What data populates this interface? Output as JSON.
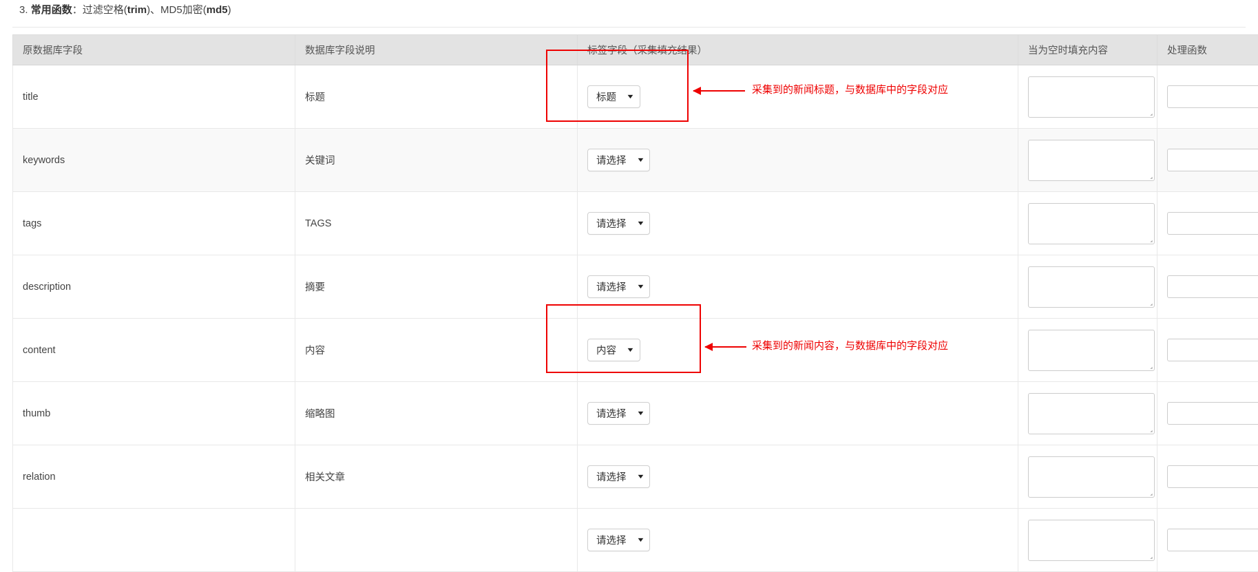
{
  "note": {
    "index": "3.",
    "label": "常用函数",
    "colon": "：",
    "body_1": "过滤空格(",
    "fn_1": "trim",
    "body_2": ")、MD5加密(",
    "fn_2": "md5",
    "body_3": ")"
  },
  "table": {
    "headers": [
      "原数据库字段",
      "数据库字段说明",
      "标签字段（采集填充结果）",
      "当为空时填充内容",
      "处理函数"
    ],
    "rows": [
      {
        "field": "title",
        "desc": "标题",
        "select": "标题",
        "empty_fill": "",
        "handler": ""
      },
      {
        "field": "keywords",
        "desc": "关键词",
        "select": "请选择",
        "empty_fill": "",
        "handler": ""
      },
      {
        "field": "tags",
        "desc": "TAGS",
        "select": "请选择",
        "empty_fill": "",
        "handler": ""
      },
      {
        "field": "description",
        "desc": "摘要",
        "select": "请选择",
        "empty_fill": "",
        "handler": ""
      },
      {
        "field": "content",
        "desc": "内容",
        "select": "内容",
        "empty_fill": "",
        "handler": ""
      },
      {
        "field": "thumb",
        "desc": "缩略图",
        "select": "请选择",
        "empty_fill": "",
        "handler": ""
      },
      {
        "field": "relation",
        "desc": "相关文章",
        "select": "请选择",
        "empty_fill": "",
        "handler": ""
      },
      {
        "field": "",
        "desc": "",
        "select": "请选择",
        "empty_fill": "",
        "handler": ""
      }
    ],
    "caret_glyph": "▼"
  },
  "annotations": [
    {
      "text": "采集到的新闻标题，与数据库中的字段对应"
    },
    {
      "text": "采集到的新闻内容，与数据库中的字段对应"
    }
  ],
  "colors": {
    "annotation_red": "#ee0000",
    "header_bg": "#e3e3e3",
    "row_alt_bg": "#f9f9f9",
    "border": "#e8e8e8"
  }
}
